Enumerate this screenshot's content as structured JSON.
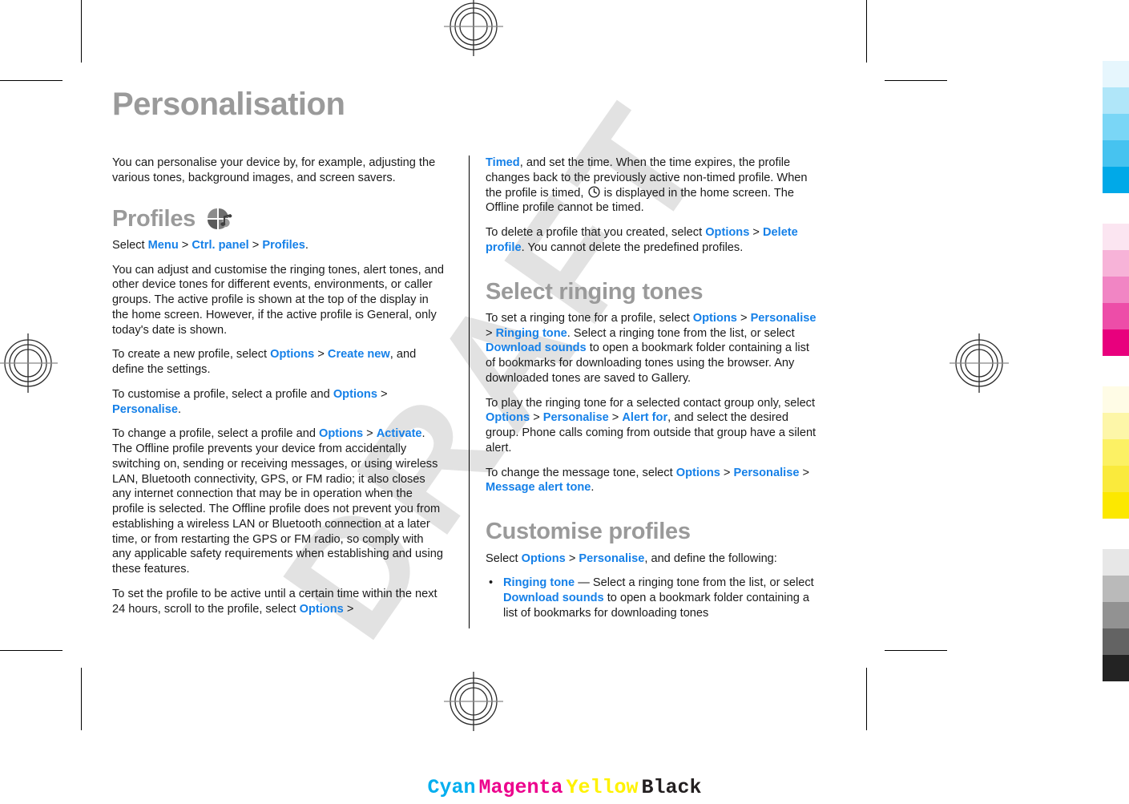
{
  "page": {
    "title": "Personalisation",
    "watermark": "DRAFT"
  },
  "left_column": {
    "intro": "You can personalise your device by, for example, adjusting the various tones, background images, and screen savers.",
    "profiles_heading": "Profiles",
    "profiles_icon": "profiles-icon",
    "select_line": {
      "lead": "Select ",
      "item1": "Menu",
      "sep1": " > ",
      "item2": "Ctrl. panel",
      "sep2": " > ",
      "item3": "Profiles",
      "tail": "."
    },
    "para_adjust": "You can adjust and customise the ringing tones, alert tones, and other device tones for different events, environments, or caller groups. The active profile is shown at the top of the display in the home screen. However, if the active profile is General, only today's date is shown.",
    "para_create": {
      "lead": "To create a new profile, select ",
      "item1": "Options",
      "sep1": " > ",
      "item2": "Create new",
      "tail": ", and define the settings."
    },
    "para_customise": {
      "lead": "To customise a profile, select a profile and ",
      "item1": "Options",
      "sep1": " > ",
      "item2": "Personalise",
      "tail": "."
    },
    "para_change": {
      "lead": "To change a profile, select a profile and ",
      "item1": "Options",
      "sep1": " > ",
      "item2": "Activate",
      "tail": ". The Offline profile prevents your device from accidentally switching on, sending or receiving messages, or using wireless LAN, Bluetooth connectivity, GPS, or FM radio; it also closes any internet connection that may be in operation when the profile is selected. The Offline profile does not prevent you from establishing a wireless LAN or Bluetooth connection at a later time, or from restarting the GPS or FM radio, so comply with any applicable safety requirements when establishing and using these features."
    },
    "para_timed_start": {
      "lead": "To set the profile to be active until a certain time within the next 24 hours, scroll to the profile, select ",
      "item1": "Options",
      "tail": " > "
    }
  },
  "right_column": {
    "para_timed_cont": {
      "item1": "Timed",
      "mid1": ", and set the time. When the time expires, the profile changes back to the previously active non-timed profile. When the profile is timed, ",
      "icon": "clock-icon",
      "mid2": " is displayed in the home screen. The Offline profile cannot be timed."
    },
    "para_delete": {
      "lead": "To delete a profile that you created, select ",
      "item1": "Options",
      "sep1": " > ",
      "item2": "Delete profile",
      "tail": ". You cannot delete the predefined profiles."
    },
    "ringing_heading": "Select ringing tones",
    "para_set_tone": {
      "lead": "To set a ringing tone for a profile, select ",
      "item1": "Options",
      "sep1": " > ",
      "item2": "Personalise",
      "sep2": " > ",
      "item3": "Ringing tone",
      "mid": ". Select a ringing tone from the list, or select ",
      "item4": "Download sounds",
      "tail": " to open a bookmark folder containing a list of bookmarks for downloading tones using the browser. Any downloaded tones are saved to Gallery."
    },
    "para_play_tone": {
      "lead": "To play the ringing tone for a selected contact group only, select ",
      "item1": "Options",
      "sep1": " > ",
      "item2": "Personalise",
      "sep2": " > ",
      "item3": "Alert for",
      "tail": ", and select the desired group. Phone calls coming from outside that group have a silent alert."
    },
    "para_message_tone": {
      "lead": "To change the message tone, select ",
      "item1": "Options",
      "sep1": " > ",
      "item2": "Personalise",
      "sep2": " > ",
      "item3": "Message alert tone",
      "tail": "."
    },
    "customise_heading": "Customise profiles",
    "para_define": {
      "lead": "Select ",
      "item1": "Options",
      "sep1": " > ",
      "item2": "Personalise",
      "tail": ", and define the following:"
    },
    "bullet_ringing_tone": {
      "dot": "•",
      "item1": "Ringing tone",
      "mid1": "  — Select a ringing tone from the list, or select ",
      "item2": "Download sounds",
      "tail": " to open a bookmark folder containing a list of bookmarks for downloading tones"
    }
  },
  "colour_bar": {
    "groups": [
      {
        "name": "cyan",
        "swatches": [
          "#e6f6fd",
          "#b0e6f9",
          "#7ad6f6",
          "#46c3f0",
          "#00a9e8"
        ]
      },
      {
        "name": "magenta",
        "swatches": [
          "#fbe5f1",
          "#f7b3d8",
          "#f185c4",
          "#ed4da8",
          "#e8007d"
        ]
      },
      {
        "name": "yellow",
        "swatches": [
          "#fffce6",
          "#fdf6a8",
          "#fcf164",
          "#faea3c",
          "#fce800"
        ]
      },
      {
        "name": "black",
        "swatches": [
          "#e7e7e7",
          "#bababa",
          "#929292",
          "#636363",
          "#232323"
        ]
      }
    ]
  },
  "cmyk_footer": {
    "labels": [
      "Cyan",
      "Magenta",
      "Yellow",
      "Black"
    ],
    "colors": [
      "#00aeef",
      "#ec008c",
      "#fff200",
      "#231f20"
    ]
  }
}
